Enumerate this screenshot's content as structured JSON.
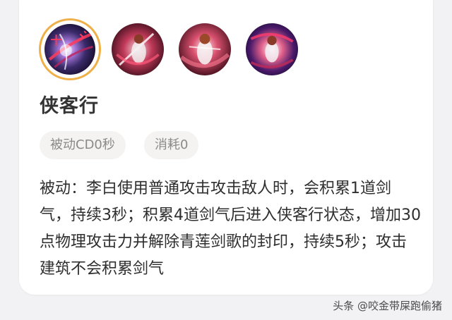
{
  "skill": {
    "name": "侠客行",
    "tags": [
      "被动CD0秒",
      "消耗0"
    ],
    "description": "被动：李白使用普通攻击攻击敌人时，会积累1道剑气，持续3秒；积累4道剑气后进入侠客行状态，增加30点物理攻击力并解除青莲剑歌的封印，持续5秒；攻击建筑不会积累剑气"
  },
  "skill_icons": [
    {
      "icon": "li-bai-passive-skill-icon",
      "selected": true,
      "seal_text": "十"
    },
    {
      "icon": "li-bai-skill-1-icon",
      "selected": false
    },
    {
      "icon": "li-bai-skill-2-icon",
      "selected": false
    },
    {
      "icon": "li-bai-skill-3-icon",
      "selected": false
    }
  ],
  "watermark": "头条 @咬金带屎跑偷猪",
  "colors": {
    "card_background": "#ffffff",
    "page_background": "#f2f2f4",
    "selected_ring": "#efb04a",
    "tag_background": "#f4f3f2",
    "tag_text": "#8c8a86"
  }
}
